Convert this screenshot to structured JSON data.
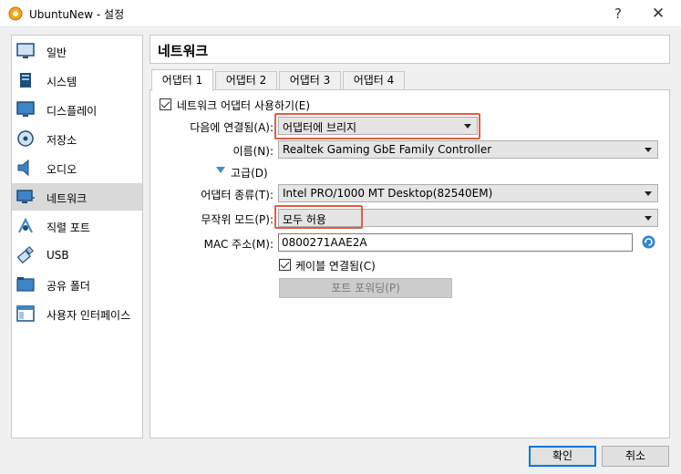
{
  "window": {
    "title": "UbuntuNew - 설정",
    "help_glyph": "?",
    "close_glyph": "✕"
  },
  "sidebar": {
    "items": [
      {
        "label": "일반",
        "icon": "general-icon"
      },
      {
        "label": "시스템",
        "icon": "system-icon"
      },
      {
        "label": "디스플레이",
        "icon": "display-icon"
      },
      {
        "label": "저장소",
        "icon": "storage-icon"
      },
      {
        "label": "오디오",
        "icon": "audio-icon"
      },
      {
        "label": "네트워크",
        "icon": "network-icon",
        "active": true
      },
      {
        "label": "직렬 포트",
        "icon": "serial-port-icon"
      },
      {
        "label": "USB",
        "icon": "usb-icon"
      },
      {
        "label": "공유 폴더",
        "icon": "shared-folder-icon"
      },
      {
        "label": "사용자 인터페이스",
        "icon": "user-interface-icon"
      }
    ]
  },
  "header": {
    "title": "네트워크"
  },
  "tabs": [
    {
      "label": "어댑터 1",
      "active": true
    },
    {
      "label": "어댑터 2"
    },
    {
      "label": "어댑터 3"
    },
    {
      "label": "어댑터 4"
    }
  ],
  "adapter": {
    "enable_label": "네트워크 어댑터 사용하기(E)",
    "enable_checked": true,
    "attached_label": "다음에 연결됨(A):",
    "attached_value": "어댑터에 브리지",
    "name_label": "이름(N):",
    "name_value": "Realtek Gaming GbE Family Controller",
    "advanced_label": "고급(D)",
    "type_label": "어댑터 종류(T):",
    "type_value": "Intel PRO/1000 MT Desktop(82540EM)",
    "promisc_label": "무작위 모드(P):",
    "promisc_value": "모두 허용",
    "mac_label": "MAC 주소(M):",
    "mac_value": "0800271AAE2A",
    "cable_label": "케이블 연결됨(C)",
    "cable_checked": true,
    "port_forward_label": "포트 포워딩(P)"
  },
  "buttons": {
    "ok": "확인",
    "cancel": "취소"
  },
  "colors": {
    "highlight": "#d9613f",
    "accent": "#0078d7",
    "active_item": "#d9d9d9"
  }
}
